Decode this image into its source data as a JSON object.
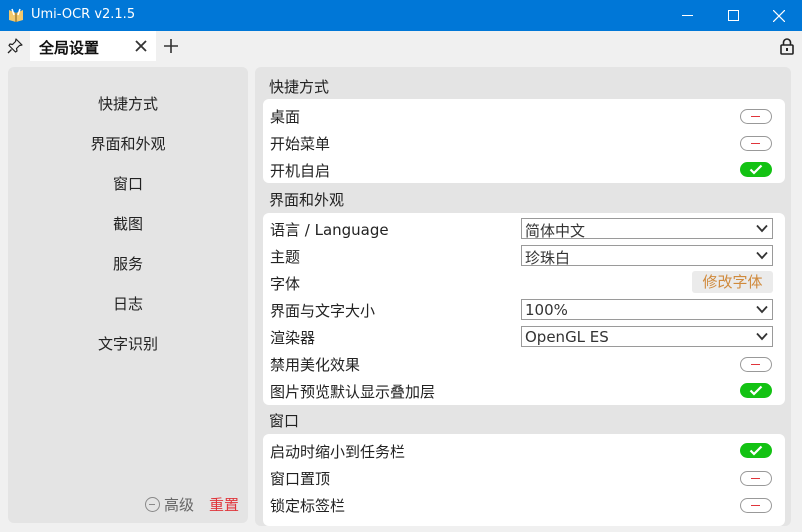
{
  "window": {
    "title": "Umi-OCR v2.1.5",
    "accent": "#0077d7"
  },
  "tabs": [
    {
      "label": "全局设置",
      "active": true
    }
  ],
  "sidebar": {
    "items": [
      {
        "label": "快捷方式"
      },
      {
        "label": "界面和外观"
      },
      {
        "label": "窗口"
      },
      {
        "label": "截图"
      },
      {
        "label": "服务"
      },
      {
        "label": "日志"
      },
      {
        "label": "文字识别"
      }
    ],
    "advanced_label": "高级",
    "reset_label": "重置",
    "reset_color": "#e0353b"
  },
  "sections": {
    "shortcuts": {
      "title": "快捷方式",
      "rows": [
        {
          "label": "桌面",
          "toggle": "off"
        },
        {
          "label": "开始菜单",
          "toggle": "off"
        },
        {
          "label": "开机自启",
          "toggle": "on"
        }
      ]
    },
    "appearance": {
      "title": "界面和外观",
      "rows": [
        {
          "label": "语言 / Language",
          "select": "简体中文"
        },
        {
          "label": "主题",
          "select": "珍珠白"
        },
        {
          "label": "字体",
          "button": "修改字体"
        },
        {
          "label": "界面与文字大小",
          "select": "100%"
        },
        {
          "label": "渲染器",
          "select": "OpenGL ES"
        },
        {
          "label": "禁用美化效果",
          "toggle": "off"
        },
        {
          "label": "图片预览默认显示叠加层",
          "toggle": "on"
        }
      ]
    },
    "window": {
      "title": "窗口",
      "rows": [
        {
          "label": "启动时缩小到任务栏",
          "toggle": "on"
        },
        {
          "label": "窗口置顶",
          "toggle": "off"
        },
        {
          "label": "锁定标签栏",
          "toggle": "off"
        }
      ]
    }
  },
  "colors": {
    "toggle_on": "#13c213",
    "toggle_off_mark": "#e0353b",
    "font_button_text": "#d08a3c"
  }
}
